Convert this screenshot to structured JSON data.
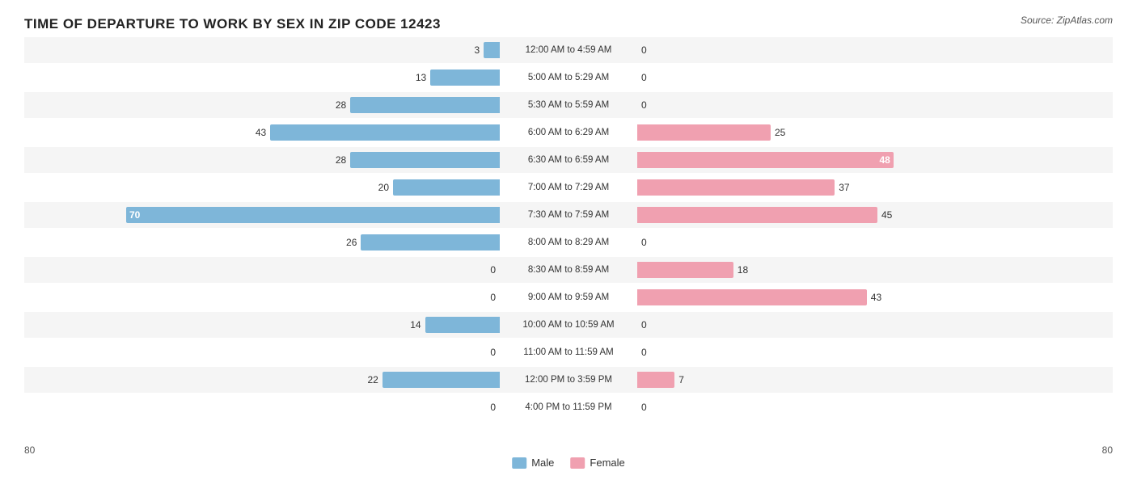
{
  "title": "TIME OF DEPARTURE TO WORK BY SEX IN ZIP CODE 12423",
  "source": "Source: ZipAtlas.com",
  "colors": {
    "male": "#7eb6d9",
    "female": "#f0a0b0",
    "male_dark": "#5a9abf",
    "female_dark": "#e07090"
  },
  "axis": {
    "left_label": "80",
    "right_label": "80"
  },
  "legend": {
    "male_label": "Male",
    "female_label": "Female"
  },
  "rows": [
    {
      "time": "12:00 AM to 4:59 AM",
      "male": 3,
      "female": 0
    },
    {
      "time": "5:00 AM to 5:29 AM",
      "male": 13,
      "female": 0
    },
    {
      "time": "5:30 AM to 5:59 AM",
      "male": 28,
      "female": 0
    },
    {
      "time": "6:00 AM to 6:29 AM",
      "male": 43,
      "female": 25
    },
    {
      "time": "6:30 AM to 6:59 AM",
      "male": 28,
      "female": 48
    },
    {
      "time": "7:00 AM to 7:29 AM",
      "male": 20,
      "female": 37
    },
    {
      "time": "7:30 AM to 7:59 AM",
      "male": 70,
      "female": 45
    },
    {
      "time": "8:00 AM to 8:29 AM",
      "male": 26,
      "female": 0
    },
    {
      "time": "8:30 AM to 8:59 AM",
      "male": 0,
      "female": 18
    },
    {
      "time": "9:00 AM to 9:59 AM",
      "male": 0,
      "female": 43
    },
    {
      "time": "10:00 AM to 10:59 AM",
      "male": 14,
      "female": 0
    },
    {
      "time": "11:00 AM to 11:59 AM",
      "male": 0,
      "female": 0
    },
    {
      "time": "12:00 PM to 3:59 PM",
      "male": 22,
      "female": 7
    },
    {
      "time": "4:00 PM to 11:59 PM",
      "male": 0,
      "female": 0
    }
  ],
  "max_value": 80
}
